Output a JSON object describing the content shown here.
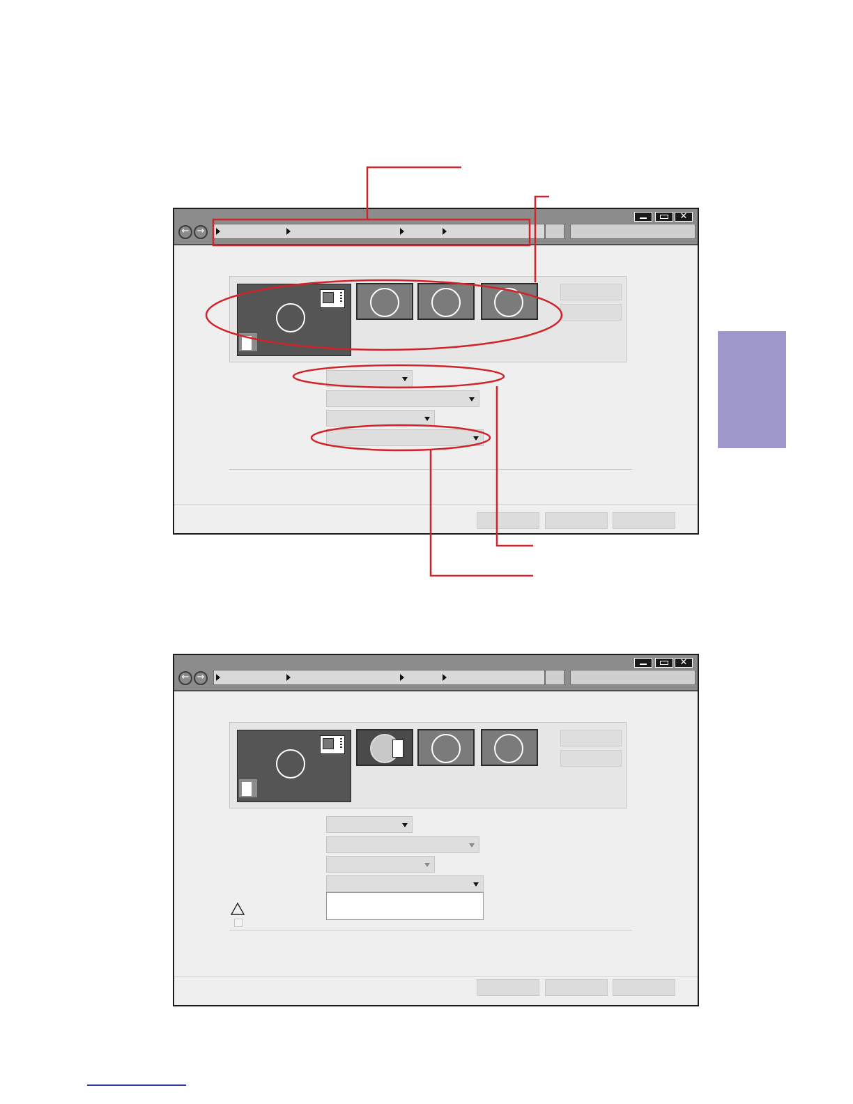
{
  "page": {
    "side_tab_color": "#9f98ca",
    "callout_color": "#d2232a",
    "link_color": "#2d3a9c"
  },
  "window_controls": {
    "minimize_icon": "minimize-icon",
    "maximize_icon": "maximize-icon",
    "close_icon": "close-icon",
    "close_glyph": "✕",
    "back_glyph": "←",
    "forward_glyph": "→"
  },
  "screens": [
    {
      "id": "screen-top",
      "callouts": [
        "breadcrumb-path",
        "monitor-thumbnails",
        "first-dropdown",
        "fourth-dropdown"
      ]
    },
    {
      "id": "screen-bottom",
      "warning_icon": "warning-triangle-icon",
      "dropdown_open": true
    }
  ]
}
